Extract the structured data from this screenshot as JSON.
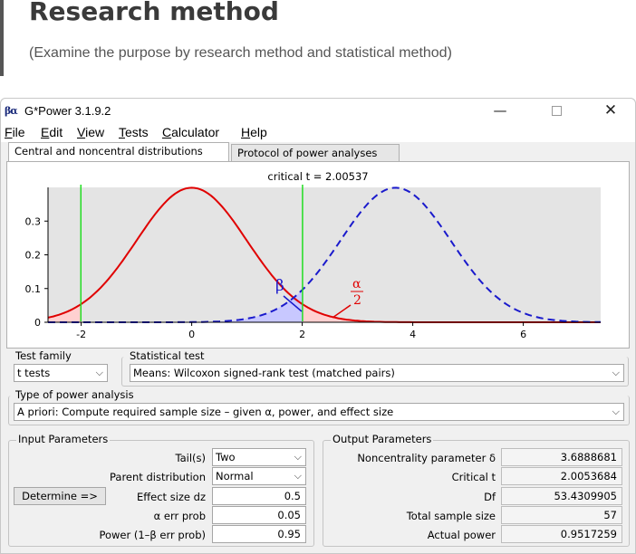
{
  "slide": {
    "title": "Research method",
    "subtitle": "(Examine the purpose by research method and statistical method)"
  },
  "window": {
    "title": "G*Power 3.1.9.2",
    "icon_text": "βα",
    "controls": {
      "minimize": "—",
      "maximize": "",
      "close": "✕"
    }
  },
  "menu": [
    "File",
    "Edit",
    "View",
    "Tests",
    "Calculator",
    "Help"
  ],
  "tabs": [
    "Central and noncentral distributions",
    "Protocol of power analyses"
  ],
  "plot": {
    "critical_label": "critical t =  2.00537",
    "y_ticks": [
      "0.3",
      "0.2",
      "0.1",
      "0"
    ],
    "x_ticks": [
      "-2",
      "0",
      "2",
      "4",
      "6"
    ],
    "beta_label": "β",
    "alpha_num": "α",
    "alpha_den": "2",
    "colors": {
      "central": "#e00000",
      "noncentral": "#1a1acc",
      "critical": "#22dd22",
      "beta_fill": "#c8c8ff",
      "alpha_fill": "#ffd0d0"
    }
  },
  "chart_data": {
    "type": "line",
    "series": [
      {
        "distribution": "central t",
        "mean": 0
      },
      {
        "distribution": "noncentral t",
        "mean": 3.6888681
      }
    ],
    "critical_lines": [
      -2.00537,
      2.00537
    ],
    "xlim": [
      -2.6,
      7.4
    ],
    "ylim": [
      0,
      0.4
    ],
    "x_ticks": [
      -2,
      0,
      2,
      4,
      6
    ],
    "y_ticks": [
      0,
      0.1,
      0.2,
      0.3
    ],
    "grid": false
  },
  "test_family": {
    "label": "Test family",
    "value": "t tests"
  },
  "statistical_test": {
    "label": "Statistical test",
    "value": "Means: Wilcoxon signed-rank test (matched pairs)"
  },
  "power_analysis": {
    "label": "Type of power analysis",
    "value": "A priori: Compute required sample size – given α, power, and effect size"
  },
  "input": {
    "title": "Input Parameters",
    "tails_label": "Tail(s)",
    "tails_value": "Two",
    "parent_label": "Parent distribution",
    "parent_value": "Normal",
    "determine_label": "Determine =>",
    "effect_label": "Effect size dz",
    "effect_value": "0.5",
    "alpha_label": "α err prob",
    "alpha_value": "0.05",
    "power_label": "Power (1–β err prob)",
    "power_value": "0.95"
  },
  "output": {
    "title": "Output Parameters",
    "ncp_label": "Noncentrality parameter δ",
    "ncp_value": "3.6888681",
    "crit_label": "Critical t",
    "crit_value": "2.0053684",
    "df_label": "Df",
    "df_value": "53.4309905",
    "n_label": "Total sample size",
    "n_value": "57",
    "power_label": "Actual power",
    "power_value": "0.9517259"
  }
}
